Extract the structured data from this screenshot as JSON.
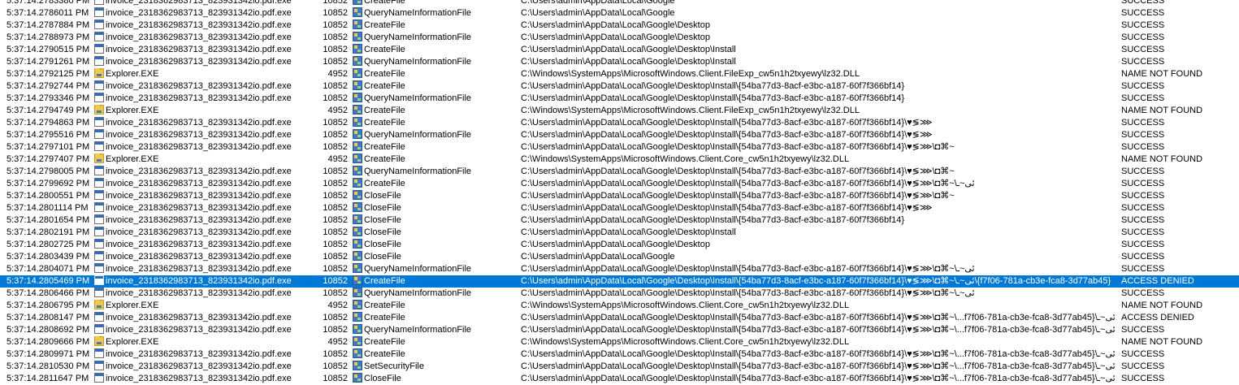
{
  "rows": [
    {
      "time": "5:37:14.2783380 PM",
      "process": "invoice_2318362983713_823931342io.pdf.exe",
      "process_icon": "exe-icon",
      "pid": "10852",
      "operation": "CreateFile",
      "path": "C:\\Users\\admin\\AppData\\Local\\Google",
      "result": "SUCCESS"
    },
    {
      "time": "5:37:14.2786011 PM",
      "process": "invoice_2318362983713_823931342io.pdf.exe",
      "process_icon": "exe-icon",
      "pid": "10852",
      "operation": "QueryNameInformationFile",
      "path": "C:\\Users\\admin\\AppData\\Local\\Google",
      "result": "SUCCESS"
    },
    {
      "time": "5:37:14.2787884 PM",
      "process": "invoice_2318362983713_823931342io.pdf.exe",
      "process_icon": "exe-icon",
      "pid": "10852",
      "operation": "CreateFile",
      "path": "C:\\Users\\admin\\AppData\\Local\\Google\\Desktop",
      "result": "SUCCESS"
    },
    {
      "time": "5:37:14.2788973 PM",
      "process": "invoice_2318362983713_823931342io.pdf.exe",
      "process_icon": "exe-icon",
      "pid": "10852",
      "operation": "QueryNameInformationFile",
      "path": "C:\\Users\\admin\\AppData\\Local\\Google\\Desktop",
      "result": "SUCCESS"
    },
    {
      "time": "5:37:14.2790515 PM",
      "process": "invoice_2318362983713_823931342io.pdf.exe",
      "process_icon": "exe-icon",
      "pid": "10852",
      "operation": "CreateFile",
      "path": "C:\\Users\\admin\\AppData\\Local\\Google\\Desktop\\Install",
      "result": "SUCCESS"
    },
    {
      "time": "5:37:14.2791261 PM",
      "process": "invoice_2318362983713_823931342io.pdf.exe",
      "process_icon": "exe-icon",
      "pid": "10852",
      "operation": "QueryNameInformationFile",
      "path": "C:\\Users\\admin\\AppData\\Local\\Google\\Desktop\\Install",
      "result": "SUCCESS"
    },
    {
      "time": "5:37:14.2792125 PM",
      "process": "Explorer.EXE",
      "process_icon": "folder-icon",
      "pid": "4952",
      "operation": "CreateFile",
      "path": "C:\\Windows\\SystemApps\\MicrosoftWindows.Client.FileExp_cw5n1h2txyewy\\lz32.DLL",
      "result": "NAME NOT FOUND"
    },
    {
      "time": "5:37:14.2792744 PM",
      "process": "invoice_2318362983713_823931342io.pdf.exe",
      "process_icon": "exe-icon",
      "pid": "10852",
      "operation": "CreateFile",
      "path": "C:\\Users\\admin\\AppData\\Local\\Google\\Desktop\\Install\\{54ba77d3-8acf-e3bc-a187-60f7f366bf14}",
      "result": "SUCCESS"
    },
    {
      "time": "5:37:14.2793346 PM",
      "process": "invoice_2318362983713_823931342io.pdf.exe",
      "process_icon": "exe-icon",
      "pid": "10852",
      "operation": "QueryNameInformationFile",
      "path": "C:\\Users\\admin\\AppData\\Local\\Google\\Desktop\\Install\\{54ba77d3-8acf-e3bc-a187-60f7f366bf14}",
      "result": "SUCCESS"
    },
    {
      "time": "5:37:14.2794749 PM",
      "process": "Explorer.EXE",
      "process_icon": "folder-icon",
      "pid": "4952",
      "operation": "CreateFile",
      "path": "C:\\Windows\\SystemApps\\MicrosoftWindows.Client.FileExp_cw5n1h2txyewy\\lz32.DLL",
      "result": "NAME NOT FOUND"
    },
    {
      "time": "5:37:14.2794863 PM",
      "process": "invoice_2318362983713_823931342io.pdf.exe",
      "process_icon": "exe-icon",
      "pid": "10852",
      "operation": "CreateFile",
      "path": "C:\\Users\\admin\\AppData\\Local\\Google\\Desktop\\Install\\{54ba77d3-8acf-e3bc-a187-60f7f366bf14}\\♥≶⋙",
      "result": "SUCCESS"
    },
    {
      "time": "5:37:14.2795516 PM",
      "process": "invoice_2318362983713_823931342io.pdf.exe",
      "process_icon": "exe-icon",
      "pid": "10852",
      "operation": "QueryNameInformationFile",
      "path": "C:\\Users\\admin\\AppData\\Local\\Google\\Desktop\\Install\\{54ba77d3-8acf-e3bc-a187-60f7f366bf14}\\♥≶⋙",
      "result": "SUCCESS"
    },
    {
      "time": "5:37:14.2797101 PM",
      "process": "invoice_2318362983713_823931342io.pdf.exe",
      "process_icon": "exe-icon",
      "pid": "10852",
      "operation": "CreateFile",
      "path": "C:\\Users\\admin\\AppData\\Local\\Google\\Desktop\\Install\\{54ba77d3-8acf-e3bc-a187-60f7f366bf14}\\♥≶⋙\\◘⌘~",
      "result": "SUCCESS"
    },
    {
      "time": "5:37:14.2797407 PM",
      "process": "Explorer.EXE",
      "process_icon": "folder-icon",
      "pid": "4952",
      "operation": "CreateFile",
      "path": "C:\\Windows\\SystemApps\\MicrosoftWindows.Client.Core_cw5n1h2txyewy\\lz32.DLL",
      "result": "NAME NOT FOUND"
    },
    {
      "time": "5:37:14.2798005 PM",
      "process": "invoice_2318362983713_823931342io.pdf.exe",
      "process_icon": "exe-icon",
      "pid": "10852",
      "operation": "QueryNameInformationFile",
      "path": "C:\\Users\\admin\\AppData\\Local\\Google\\Desktop\\Install\\{54ba77d3-8acf-e3bc-a187-60f7f366bf14}\\♥≶⋙\\◘⌘~",
      "result": "SUCCESS"
    },
    {
      "time": "5:37:14.2799692 PM",
      "process": "invoice_2318362983713_823931342io.pdf.exe",
      "process_icon": "exe-icon",
      "pid": "10852",
      "operation": "CreateFile",
      "path": "C:\\Users\\admin\\AppData\\Local\\Google\\Desktop\\Install\\{54ba77d3-8acf-e3bc-a187-60f7f366bf14}\\♥≶⋙\\◘⌘~\\ئى~ـ",
      "result": "SUCCESS"
    },
    {
      "time": "5:37:14.2800551 PM",
      "process": "invoice_2318362983713_823931342io.pdf.exe",
      "process_icon": "exe-icon",
      "pid": "10852",
      "operation": "CloseFile",
      "path": "C:\\Users\\admin\\AppData\\Local\\Google\\Desktop\\Install\\{54ba77d3-8acf-e3bc-a187-60f7f366bf14}\\♥≶⋙\\◘⌘~",
      "result": "SUCCESS"
    },
    {
      "time": "5:37:14.2801114 PM",
      "process": "invoice_2318362983713_823931342io.pdf.exe",
      "process_icon": "exe-icon",
      "pid": "10852",
      "operation": "CloseFile",
      "path": "C:\\Users\\admin\\AppData\\Local\\Google\\Desktop\\Install\\{54ba77d3-8acf-e3bc-a187-60f7f366bf14}\\♥≶⋙",
      "result": "SUCCESS"
    },
    {
      "time": "5:37:14.2801654 PM",
      "process": "invoice_2318362983713_823931342io.pdf.exe",
      "process_icon": "exe-icon",
      "pid": "10852",
      "operation": "CloseFile",
      "path": "C:\\Users\\admin\\AppData\\Local\\Google\\Desktop\\Install\\{54ba77d3-8acf-e3bc-a187-60f7f366bf14}",
      "result": "SUCCESS"
    },
    {
      "time": "5:37:14.2802191 PM",
      "process": "invoice_2318362983713_823931342io.pdf.exe",
      "process_icon": "exe-icon",
      "pid": "10852",
      "operation": "CloseFile",
      "path": "C:\\Users\\admin\\AppData\\Local\\Google\\Desktop\\Install",
      "result": "SUCCESS"
    },
    {
      "time": "5:37:14.2802725 PM",
      "process": "invoice_2318362983713_823931342io.pdf.exe",
      "process_icon": "exe-icon",
      "pid": "10852",
      "operation": "CloseFile",
      "path": "C:\\Users\\admin\\AppData\\Local\\Google\\Desktop",
      "result": "SUCCESS"
    },
    {
      "time": "5:37:14.2803439 PM",
      "process": "invoice_2318362983713_823931342io.pdf.exe",
      "process_icon": "exe-icon",
      "pid": "10852",
      "operation": "CloseFile",
      "path": "C:\\Users\\admin\\AppData\\Local\\Google",
      "result": "SUCCESS"
    },
    {
      "time": "5:37:14.2804071 PM",
      "process": "invoice_2318362983713_823931342io.pdf.exe",
      "process_icon": "exe-icon",
      "pid": "10852",
      "operation": "QueryNameInformationFile",
      "path": "C:\\Users\\admin\\AppData\\Local\\Google\\Desktop\\Install\\{54ba77d3-8acf-e3bc-a187-60f7f366bf14}\\♥≶⋙\\◘⌘~\\ئى~ـ",
      "result": "SUCCESS"
    },
    {
      "time": "5:37:14.2805469 PM",
      "process": "invoice_2318362983713_823931342io.pdf.exe",
      "process_icon": "exe-icon",
      "pid": "10852",
      "operation": "CreateFile",
      "path": "C:\\Users\\admin\\AppData\\Local\\Google\\Desktop\\Install\\{54ba77d3-8acf-e3bc-a187-60f7f366bf14}\\♥≶⋙\\◘⌘~\\ئى~ـ\\{f7f06-781a-cb3e-fca8-3d77ab45}",
      "result": "ACCESS DENIED",
      "selected": true
    },
    {
      "time": "5:37:14.2806466 PM",
      "process": "invoice_2318362983713_823931342io.pdf.exe",
      "process_icon": "exe-icon",
      "pid": "10852",
      "operation": "QueryNameInformationFile",
      "path": "C:\\Users\\admin\\AppData\\Local\\Google\\Desktop\\Install\\{54ba77d3-8acf-e3bc-a187-60f7f366bf14}\\♥≶⋙\\◘⌘~\\ئى~ـ",
      "result": "SUCCESS"
    },
    {
      "time": "5:37:14.2806795 PM",
      "process": "Explorer.EXE",
      "process_icon": "folder-icon",
      "pid": "4952",
      "operation": "CreateFile",
      "path": "C:\\Windows\\SystemApps\\MicrosoftWindows.Client.Core_cw5n1h2txyewy\\lz32.DLL",
      "result": "NAME NOT FOUND"
    },
    {
      "time": "5:37:14.2808147 PM",
      "process": "invoice_2318362983713_823931342io.pdf.exe",
      "process_icon": "exe-icon",
      "pid": "10852",
      "operation": "CreateFile",
      "path": "C:\\Users\\admin\\AppData\\Local\\Google\\Desktop\\Install\\{54ba77d3-8acf-e3bc-a187-60f7f366bf14}\\♥≶⋙\\◘⌘~\\...f7f06-781a-cb3e-fca8-3d77ab45}\\ئى~ـ",
      "result": "ACCESS DENIED"
    },
    {
      "time": "5:37:14.2808692 PM",
      "process": "invoice_2318362983713_823931342io.pdf.exe",
      "process_icon": "exe-icon",
      "pid": "10852",
      "operation": "QueryNameInformationFile",
      "path": "C:\\Users\\admin\\AppData\\Local\\Google\\Desktop\\Install\\{54ba77d3-8acf-e3bc-a187-60f7f366bf14}\\♥≶⋙\\◘⌘~\\...f7f06-781a-cb3e-fca8-3d77ab45}\\ئى~ـ",
      "result": "SUCCESS"
    },
    {
      "time": "5:37:14.2809666 PM",
      "process": "Explorer.EXE",
      "process_icon": "folder-icon",
      "pid": "4952",
      "operation": "CreateFile",
      "path": "C:\\Windows\\SystemApps\\MicrosoftWindows.Client.Core_cw5n1h2txyewy\\lz32.DLL",
      "result": "NAME NOT FOUND"
    },
    {
      "time": "5:37:14.2809971 PM",
      "process": "invoice_2318362983713_823931342io.pdf.exe",
      "process_icon": "exe-icon",
      "pid": "10852",
      "operation": "CreateFile",
      "path": "C:\\Users\\admin\\AppData\\Local\\Google\\Desktop\\Install\\{54ba77d3-8acf-e3bc-a187-60f7f366bf14}\\♥≶⋙\\◘⌘~\\...f7f06-781a-cb3e-fca8-3d77ab45}\\ئى~ـ",
      "result": "SUCCESS"
    },
    {
      "time": "5:37:14.2810530 PM",
      "process": "invoice_2318362983713_823931342io.pdf.exe",
      "process_icon": "exe-icon",
      "pid": "10852",
      "operation": "SetSecurityFile",
      "path": "C:\\Users\\admin\\AppData\\Local\\Google\\Desktop\\Install\\{54ba77d3-8acf-e3bc-a187-60f7f366bf14}\\♥≶⋙\\◘⌘~\\...f7f06-781a-cb3e-fca8-3d77ab45}\\ئى~ـ",
      "result": "SUCCESS"
    },
    {
      "time": "5:37:14.2811647 PM",
      "process": "invoice_2318362983713_823931342io.pdf.exe",
      "process_icon": "exe-icon",
      "pid": "10852",
      "operation": "CloseFile",
      "path": "C:\\Users\\admin\\AppData\\Local\\Google\\Desktop\\Install\\{54ba77d3-8acf-e3bc-a187-60f7f366bf14}\\♥≶⋙\\◘⌘~\\...f7f06-781a-cb3e-fca8-3d77ab45}\\ئى~ـ",
      "result": "SUCCESS"
    }
  ],
  "colors": {
    "selection": "#0078d7",
    "selection_text": "#ffffff",
    "text": "#000000",
    "background": "#ffffff"
  },
  "icons": {
    "exe": "exe-icon",
    "explorer": "folder-icon",
    "operation": "filesystem-operation-icon"
  }
}
